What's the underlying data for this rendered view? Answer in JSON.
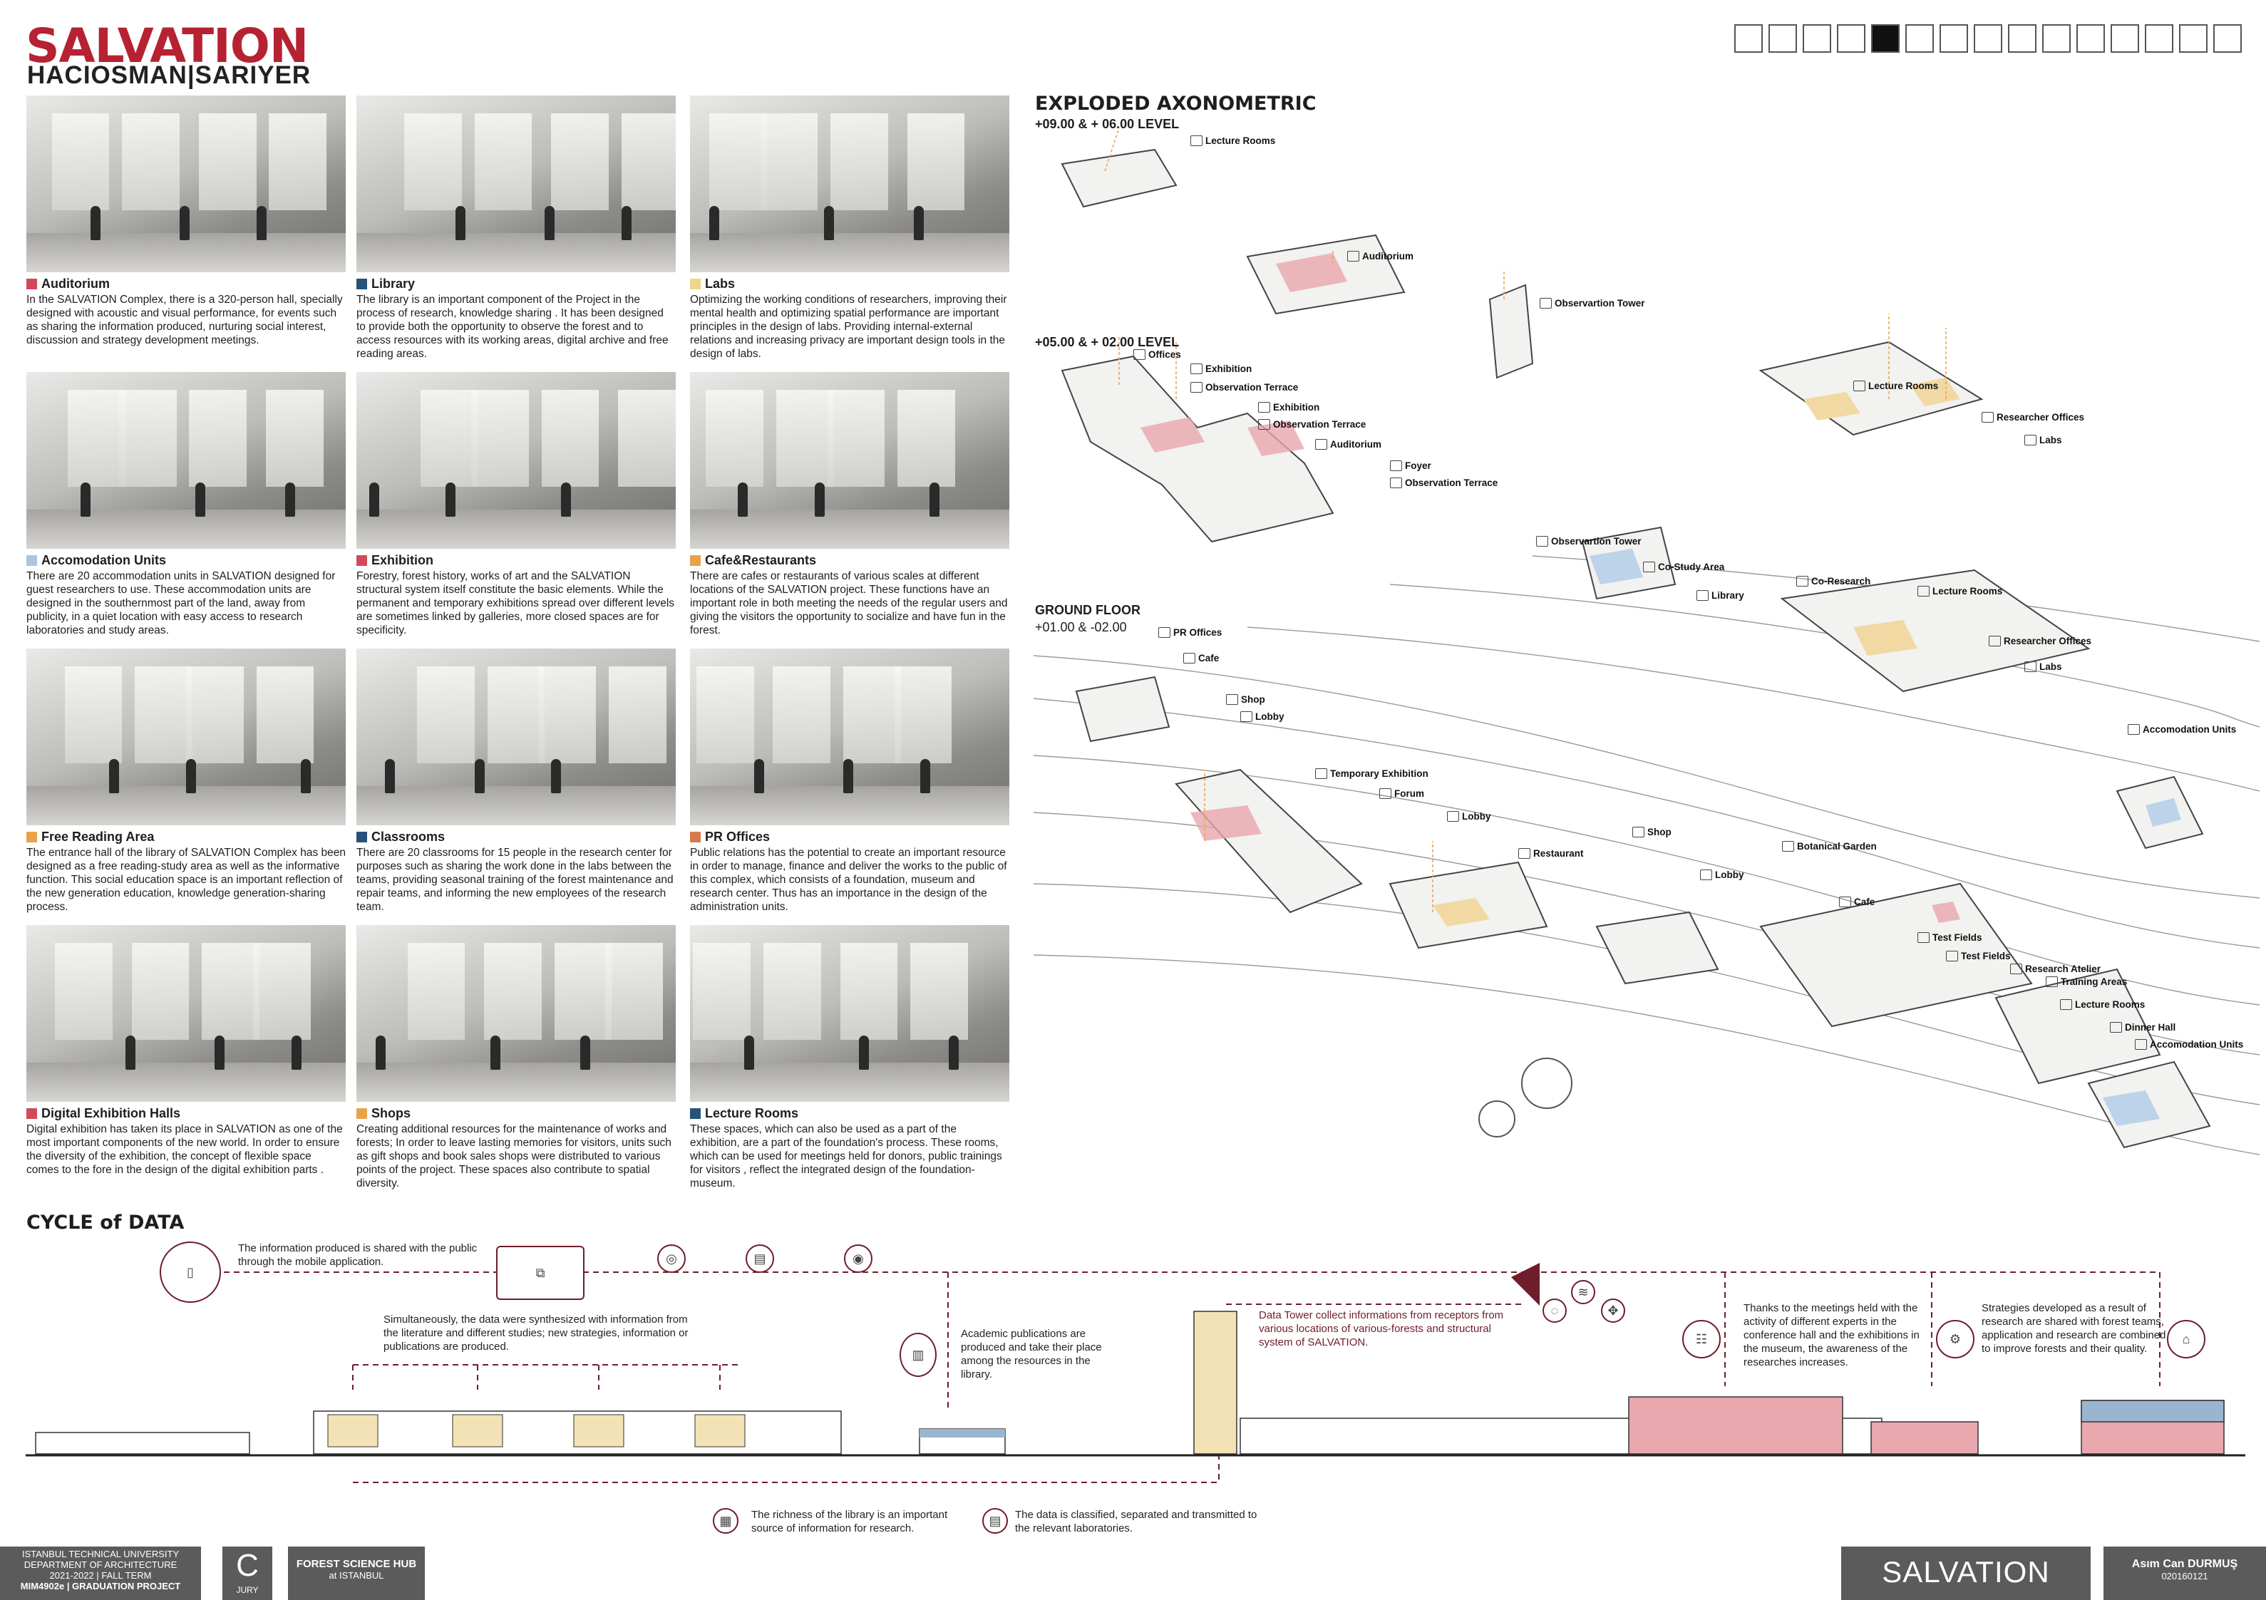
{
  "header": {
    "title": "SALVATION",
    "subtitle": "HACIOSMAN|SARIYER"
  },
  "pager": {
    "count": 15,
    "active_index": 4
  },
  "cells": [
    {
      "title": "Auditorium",
      "color": "#d24a59",
      "text": "In the SALVATION Complex, there is a 320-person hall, specially designed with acoustic and visual performance, for events such as sharing the information produced, nurturing social interest, discussion and strategy development meetings."
    },
    {
      "title": "Library",
      "color": "#27527a",
      "text": "The library is an important component of the Project in the process of research, knowledge sharing . It has been designed to provide both the opportunity to observe the forest and to access resources with its working areas, digital archive and free reading areas."
    },
    {
      "title": "Labs",
      "color": "#f0d58a",
      "text": "Optimizing the working conditions of researchers, improving their mental health and optimizing spatial performance are important principles in the design of labs. Providing internal-external relations and increasing privacy are important design tools in the design of labs."
    },
    {
      "title": "Accomodation Units",
      "color": "#a8c5e2",
      "text": "There are 20 accommodation units in SALVATION designed for guest researchers to use. These accommodation units are designed in the southernmost part of the land, away from publicity, in a quiet location with easy access to research laboratories and study areas."
    },
    {
      "title": "Exhibition",
      "color": "#d24a59",
      "text": "Forestry, forest history, works of art and the SALVATION structural system itself constitute the basic elements. While the permanent and temporary exhibitions spread over different levels are sometimes linked by galleries, more closed spaces are for specificity."
    },
    {
      "title": "Cafe&Restaurants",
      "color": "#e8a34a",
      "text": "There are cafes or restaurants of various scales at different locations of the SALVATION project. These functions have an important role in both meeting the needs of the regular users and giving the visitors the opportunity to socialize and have fun in the forest."
    },
    {
      "title": "Free Reading Area",
      "color": "#e8a34a",
      "text": "The entrance hall of the library of SALVATION Complex has been designed as a free reading-study area as well as the informative function. This social education space is an important reflection of the new generation education, knowledge generation-sharing process."
    },
    {
      "title": "Classrooms",
      "color": "#27527a",
      "text": "There are 20 classrooms for 15 people in the research center for purposes such as sharing the work done in the labs between the teams, providing seasonal training of the forest maintenance and repair teams, and informing the new employees of the research team."
    },
    {
      "title": "PR Offices",
      "color": "#d77a4a",
      "text": "Public relations has the potential to create an important resource in order to manage, finance and deliver the works to the public of this complex, which consists of a foundation, museum and research center. Thus has an importance in the design of the administration units."
    },
    {
      "title": "Digital Exhibition Halls",
      "color": "#d24a59",
      "text": "Digital exhibition has taken its place in SALVATION as one of the most important components of the new world. In order to ensure the diversity of the exhibition, the concept of flexible space comes to the fore in the design of the digital exhibition parts ."
    },
    {
      "title": "Shops",
      "color": "#e8a34a",
      "text": "Creating additional resources for the maintenance of works and forests; In order to leave lasting memories for visitors, units such as gift shops and book sales shops were distributed to various points of the project. These spaces also contribute to spatial diversity."
    },
    {
      "title": "Lecture Rooms",
      "color": "#27527a",
      "text": "These spaces, which can also be used as a part of the exhibition, are a part of the foundation's process. These rooms, which can be used for meetings held for donors, public trainings for visitors , reflect the integrated design of the foundation-museum."
    }
  ],
  "axo": {
    "title": "EXPLODED AXONOMETRIC",
    "level1": "+09.00 & + 06.00 LEVEL",
    "level2": "+05.00 & + 02.00 LEVEL",
    "level3a": "GROUND FLOOR",
    "level3b": "+01.00 & -02.00",
    "labels": [
      "Lecture Rooms",
      "Auditorium",
      "Observartion Tower",
      "Offices",
      "Exhibition",
      "Observation Terrace",
      "Exhibition",
      "Observation Terrace",
      "Auditorium",
      "Foyer",
      "Observation Terrace",
      "Lecture Rooms",
      "Researcher Offices",
      "Labs",
      "Observartion Tower",
      "Co-Study Area",
      "Library",
      "Co-Research",
      "Lecture Rooms",
      "Researcher Offices",
      "Labs",
      "Accomodation Units",
      "PR Offices",
      "Cafe",
      "Shop",
      "Lobby",
      "Temporary Exhibition",
      "Forum",
      "Lobby",
      "Restaurant",
      "Shop",
      "Botanical Garden",
      "Lobby",
      "Cafe",
      "Test Fields",
      "Test Fields",
      "Research Atelier",
      "Training Areas",
      "Lecture Rooms",
      "Dinner Hall",
      "Accomodation Units"
    ]
  },
  "cycle": {
    "title": "CYCLE of DATA",
    "t1": "The information produced is shared with the public through the mobile application.",
    "t2": "Simultaneously, the data were synthesized with information from the literature and different studies; new strategies, information or publications are produced.",
    "t3": "Academic publications are produced and take their place among the resources in the library.",
    "t4": "Data Tower collect informations from receptors from various locations of various-forests and structural system of SALVATION.",
    "t5": "Thanks to the meetings held with the activity of different experts in the conference hall and the exhibitions in the museum, the awareness of the researches increases.",
    "t6": "Strategies developed as a result of research are shared with forest teams, application and research are combined to improve forests and their quality.",
    "t7": "The richness of the library is an important source of information for research.",
    "t8": "The data is classified, separated and transmitted to the relevant laboratories."
  },
  "footer": {
    "itu1": "ISTANBUL TECHNICAL UNIVERSITY",
    "itu2": "DEPARTMENT OF ARCHITECTURE",
    "itu3": "2021-2022 | FALL TERM",
    "itu4": "MIM4902e | GRADUATION PROJECT",
    "c": "C",
    "jury": "JURY",
    "hub": "FOREST SCIENCE HUB",
    "hub_sub": "at ISTANBUL",
    "project": "SALVATION",
    "author": "Asım Can DURMUŞ",
    "id": "020160121"
  }
}
